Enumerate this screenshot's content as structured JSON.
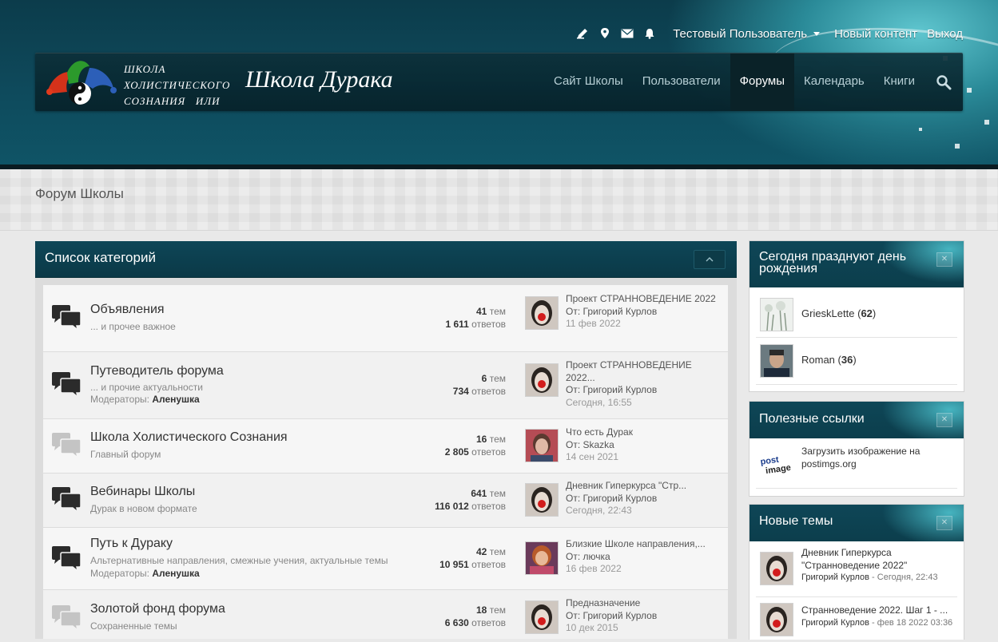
{
  "header": {
    "user_menu": {
      "icons": [
        "pencil-icon",
        "map-marker-icon",
        "envelope-icon",
        "bell-icon"
      ],
      "username": "Тестовый Пользователь",
      "new_content": "Новый контент",
      "logout": "Выход"
    },
    "logo": {
      "line1": "ШКОЛА",
      "line2": "ХОЛИСТИЧЕСКОГО",
      "line3": "СОЗНАНИЯ   ИЛИ",
      "title": "Школа Дурака"
    },
    "nav": [
      {
        "label": "Сайт Школы",
        "active": false
      },
      {
        "label": "Пользователи",
        "active": false
      },
      {
        "label": "Форумы",
        "active": true
      },
      {
        "label": "Календарь",
        "active": false
      },
      {
        "label": "Книги",
        "active": false
      }
    ]
  },
  "page": {
    "title": "Форум Школы"
  },
  "categories_panel": {
    "title": "Список категорий",
    "rows": [
      {
        "name": "Объявления",
        "description": "... и прочее важное",
        "moderators_label": "",
        "moderators": "",
        "topics": "41",
        "topics_label": "тем",
        "replies": "1 611",
        "replies_label": "ответов",
        "last_title": "Проект СТРАННОВЕДЕНИЕ 2022",
        "last_author": "От: Григорий Курлов",
        "last_date": "11 фев 2022",
        "unread": true
      },
      {
        "name": "Путеводитель форума",
        "description": "... и прочие актуальности",
        "moderators_label": "Модераторы:",
        "moderators": "Аленушка",
        "topics": "6",
        "topics_label": "тем",
        "replies": "734",
        "replies_label": "ответов",
        "last_title": "Проект СТРАННОВЕДЕНИЕ 2022...",
        "last_author": "От: Григорий Курлов",
        "last_date": "Сегодня, 16:55",
        "unread": true
      },
      {
        "name": "Школа Холистического Сознания",
        "description": "Главный форум",
        "moderators_label": "",
        "moderators": "",
        "topics": "16",
        "topics_label": "тем",
        "replies": "2 805",
        "replies_label": "ответов",
        "last_title": "Что есть Дурак",
        "last_author": "От: Skazka",
        "last_date": "14 сен 2021",
        "unread": false
      },
      {
        "name": "Вебинары Школы",
        "description": "Дурак в новом формате",
        "moderators_label": "",
        "moderators": "",
        "topics": "641",
        "topics_label": "тем",
        "replies": "116 012",
        "replies_label": "ответов",
        "last_title": "Дневник Гиперкурса \"Стр...",
        "last_author": "От: Григорий Курлов",
        "last_date": "Сегодня, 22:43",
        "unread": true
      },
      {
        "name": "Путь к Дураку",
        "description": "Альтернативные направления, смежные учения, актуальные темы",
        "moderators_label": "Модераторы:",
        "moderators": "Аленушка",
        "topics": "42",
        "topics_label": "тем",
        "replies": "10 951",
        "replies_label": "ответов",
        "last_title": "Близкие Школе направления,...",
        "last_author": "От: лючка",
        "last_date": "16 фев 2022",
        "unread": true
      },
      {
        "name": "Золотой фонд форума",
        "description": "Сохраненные темы",
        "moderators_label": "",
        "moderators": "",
        "topics": "18",
        "topics_label": "тем",
        "replies": "6 630",
        "replies_label": "ответов",
        "last_title": "Предназначение",
        "last_author": "От: Григорий Курлов",
        "last_date": "10 дек 2015",
        "unread": false
      }
    ]
  },
  "sidebar": {
    "birthdays": {
      "title": "Сегодня празднуют день рождения",
      "items": [
        {
          "name": "GrieskLette",
          "age": "62"
        },
        {
          "name": "Roman",
          "age": "36"
        }
      ]
    },
    "links": {
      "title": "Полезные ссылки",
      "items": [
        {
          "text": "Загрузить изображение на postimgs.org",
          "logo_text": "postimage"
        }
      ]
    },
    "new_topics": {
      "title": "Новые темы",
      "items": [
        {
          "title": "Дневник Гиперкурса \"Странноведение 2022\"",
          "author": "Григорий Курлов",
          "date": "- Сегодня, 22:43"
        },
        {
          "title": "Странноведение 2022. Шаг 1 - ...",
          "author": "Григорий Курлов",
          "date": "- фев 18 2022 03:36"
        }
      ]
    }
  },
  "colors": {
    "header_bg": "#0e4a5c",
    "panel_header": "#0e4657",
    "unread_icon": "#2b2b2b",
    "read_icon": "#c4c4c4"
  }
}
